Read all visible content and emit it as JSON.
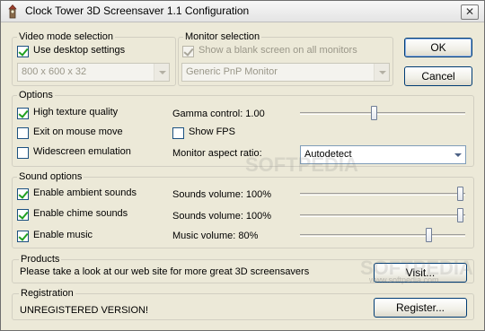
{
  "window": {
    "title": "Clock Tower 3D Screensaver 1.1 Configuration",
    "close_glyph": "✕",
    "icon": "clock-tower-app-icon"
  },
  "video_mode": {
    "group_label": "Video mode selection",
    "use_desktop_label": "Use desktop settings",
    "use_desktop_checked": true,
    "resolution_value": "800 x 600 x 32",
    "resolution_disabled": true
  },
  "monitor": {
    "group_label": "Monitor selection",
    "blank_screen_label": "Show a blank screen on all monitors",
    "blank_screen_checked": true,
    "blank_screen_disabled": true,
    "monitor_value": "Generic PnP Monitor",
    "monitor_disabled": true
  },
  "buttons": {
    "ok": "OK",
    "cancel": "Cancel",
    "visit": "Visit...",
    "register": "Register..."
  },
  "options": {
    "group_label": "Options",
    "high_texture_label": "High texture quality",
    "high_texture_checked": true,
    "exit_mouse_label": "Exit on mouse move",
    "exit_mouse_checked": false,
    "widescreen_label": "Widescreen emulation",
    "widescreen_checked": false,
    "gamma_label": "Gamma control: 1.00",
    "gamma_level": 0.45,
    "show_fps_label": "Show FPS",
    "show_fps_checked": false,
    "aspect_label": "Monitor aspect ratio:",
    "aspect_value": "Autodetect"
  },
  "sound": {
    "group_label": "Sound options",
    "ambient_label": "Enable ambient sounds",
    "ambient_checked": true,
    "chime_label": "Enable chime sounds",
    "chime_checked": true,
    "music_label": "Enable music",
    "music_checked": true,
    "sounds_volume_label": "Sounds volume: 100%",
    "sounds_volume_level": 1.0,
    "chime_volume_label": "Sounds volume: 100%",
    "chime_volume_level": 1.0,
    "music_volume_label": "Music volume: 80%",
    "music_volume_level": 0.8
  },
  "products": {
    "group_label": "Products",
    "text": "Please take a look at our web site for more great 3D screensavers"
  },
  "registration": {
    "group_label": "Registration",
    "status": "UNREGISTERED VERSION!"
  },
  "colors": {
    "check_mark": "#21a121",
    "dialog_bg": "#ece9d8",
    "button_border": "#003c74"
  },
  "watermarks": {
    "brand_1": "SOFTPEDIA",
    "brand_2": "SOFTPEDIA",
    "url": "www.softpedia.com"
  }
}
